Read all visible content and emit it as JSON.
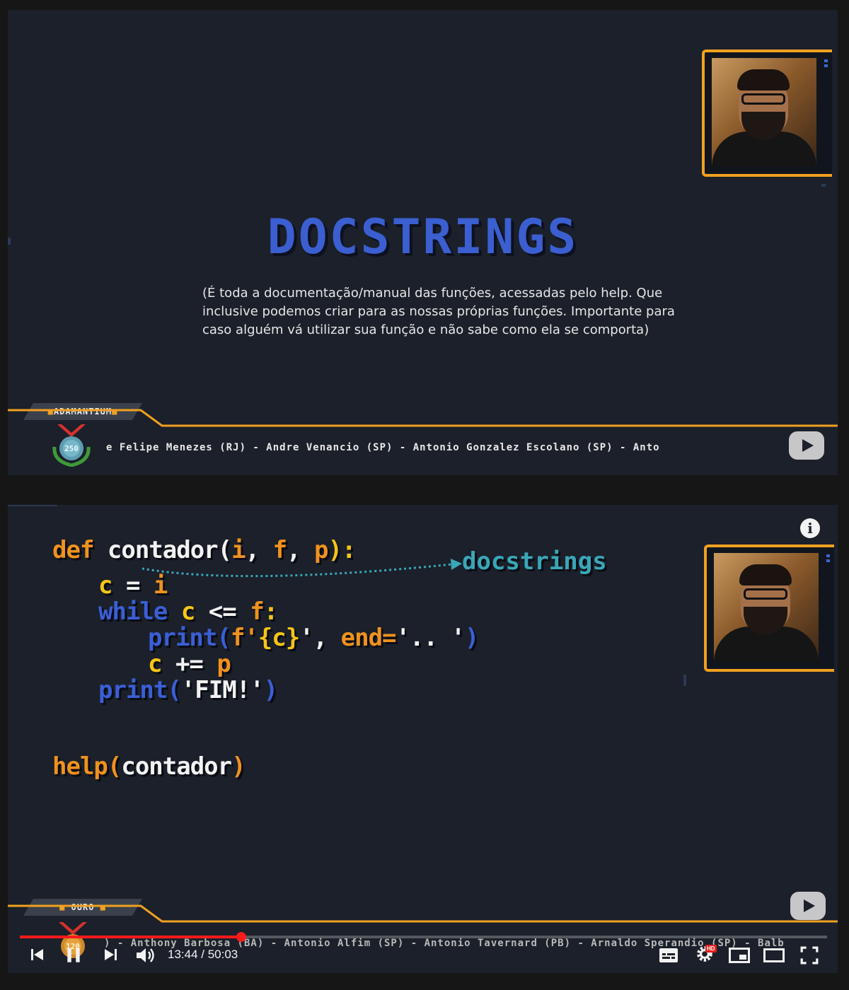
{
  "slide1": {
    "title": "DOCSTRINGS",
    "description": "(É toda a documentação/manual das funções, acessadas pelo help. Que inclusive podemos criar para as nossas próprias funções. Importante para caso alguém vá utilizar sua função e não sabe como ela se comporta)",
    "tier_label": "ADAMANTIUM",
    "medal_number": "250",
    "ticker": "e Felipe Menezes (RJ) - Andre Venancio (SP) - Antonio Gonzalez Escolano (SP) - Anto"
  },
  "slide2": {
    "code_lines": [
      [
        "def ",
        "contador(",
        "i",
        ", ",
        "f",
        ", ",
        "p",
        "):"
      ],
      [
        "c ",
        "= ",
        "i"
      ],
      [
        "while ",
        "c ",
        "<= ",
        "f",
        ":"
      ],
      [
        "print(",
        "f'",
        "{c}",
        "', ",
        "end=",
        "'.. '",
        ")"
      ],
      [
        "c ",
        "+= ",
        "p"
      ],
      [
        "print(",
        "'FIM!'",
        ")"
      ],
      [
        "help(",
        "contador",
        ")"
      ]
    ],
    "annotation": "docstrings",
    "info_label": "i",
    "tier_label": "OURO",
    "medal_number": "120",
    "ticker": ") - Anthony Barbosa (BA) - Antonio Alfim (SP) - Antonio Tavernard (PB) - Arnaldo Sperandio (SP) - Balb"
  },
  "player": {
    "current_time": "13:44",
    "separator": " / ",
    "duration": "50:03",
    "progress": 0.2745,
    "hd_badge": "HD",
    "icons": [
      "previous-icon",
      "pause-icon",
      "next-icon",
      "volume-icon",
      "subtitles-icon",
      "settings-icon",
      "miniplayer-icon",
      "theater-icon",
      "fullscreen-icon"
    ]
  },
  "colors": {
    "frame_bg": "#1b202a",
    "accent_orange": "#f0a020",
    "title_blue": "#3b5fd0",
    "progress_red": "#ff1a1a",
    "annotation_teal": "#3aa7b8"
  }
}
